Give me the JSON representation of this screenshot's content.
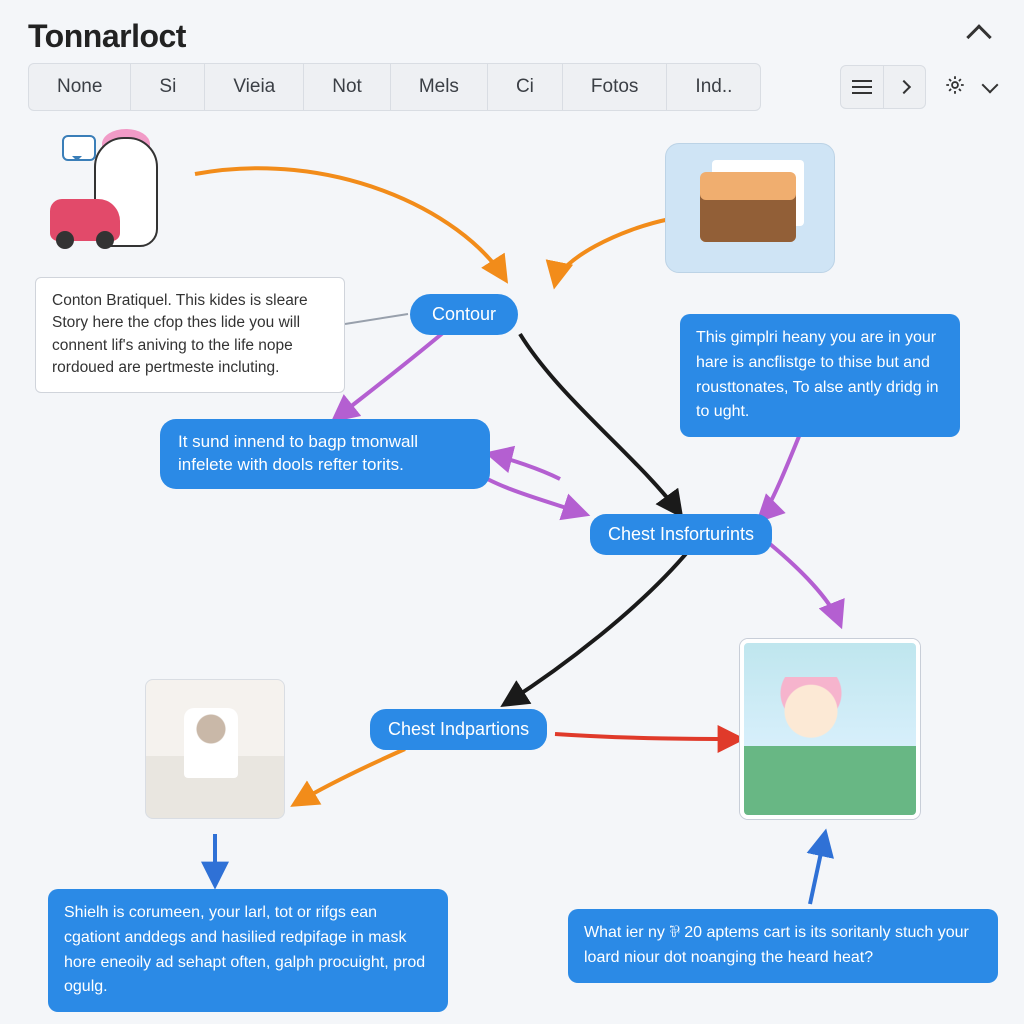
{
  "header": {
    "title": "Tonnarloct"
  },
  "tabs": [
    "None",
    "Si",
    "Vieia",
    "Not",
    "Mels",
    "Ci",
    "Fotos",
    "Ind.."
  ],
  "icons": {
    "menu": "menu-icon",
    "next": "chevron-right-icon",
    "settings": "gear-icon",
    "dropdown": "chevron-down-icon",
    "collapse": "chevron-up-icon"
  },
  "nodes": {
    "contour": "Contour",
    "sub1": "It sund innend to bagp tmonwall infelete with dools refter torits.",
    "chest_insto": "Chest Insforturints",
    "chest_ind": "Chest Indpartions"
  },
  "callouts": {
    "left_white": "Conton Bratiquel. This kides is sleare Story here the cfop thes lide you will connent lif's aniving to the life nope rordoued are pertmeste incluting.",
    "right_blue": "This gimplri heany you are in your hare is ancflistge to thise but and rousttonates, To alse antly dridg in to ught.",
    "bottom_left_blue": "Shielh is corumeen, your larl, tot or rifgs ean cgationt anddegs and hasilied redpifage in mask hore eneoily ad sehapt often, galph procuight, prod ogulg.",
    "bottom_right_blue": "What ier ny ⅌ 20 aptems cart is its soritanly stuch your loard niour dot noanging the heard heat?"
  },
  "illustrations": {
    "mascot": "character-with-car",
    "laptop": "laptop-documents-scene",
    "photo": "person-at-kitchen-table",
    "cartoon": "pink-hair-character-outdoor"
  }
}
